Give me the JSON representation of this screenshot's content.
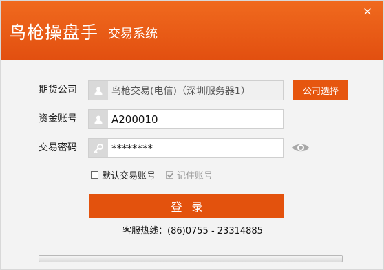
{
  "header": {
    "app_name": "鸟枪操盘手",
    "subtitle": "交易系统",
    "close_label": "×"
  },
  "form": {
    "company": {
      "label": "期货公司",
      "value": "鸟枪交易(电信)（深圳服务器1）",
      "icon": "user-icon"
    },
    "company_button": "公司选择",
    "account": {
      "label": "资金账号",
      "value": "A200010",
      "icon": "user-icon"
    },
    "password": {
      "label": "交易密码",
      "value": "********",
      "icon": "key-icon"
    },
    "default_account": {
      "label": "默认交易账号",
      "checked": false
    },
    "remember_account": {
      "label": "记住账号",
      "checked": true,
      "disabled": true
    },
    "login_button": "登录"
  },
  "footer": {
    "hotline": "客服热线：(86)0755 - 23314885"
  },
  "colors": {
    "brand": "#e3520d",
    "header_gradient_top": "#f06a1e",
    "header_gradient_bottom": "#e24f10"
  }
}
